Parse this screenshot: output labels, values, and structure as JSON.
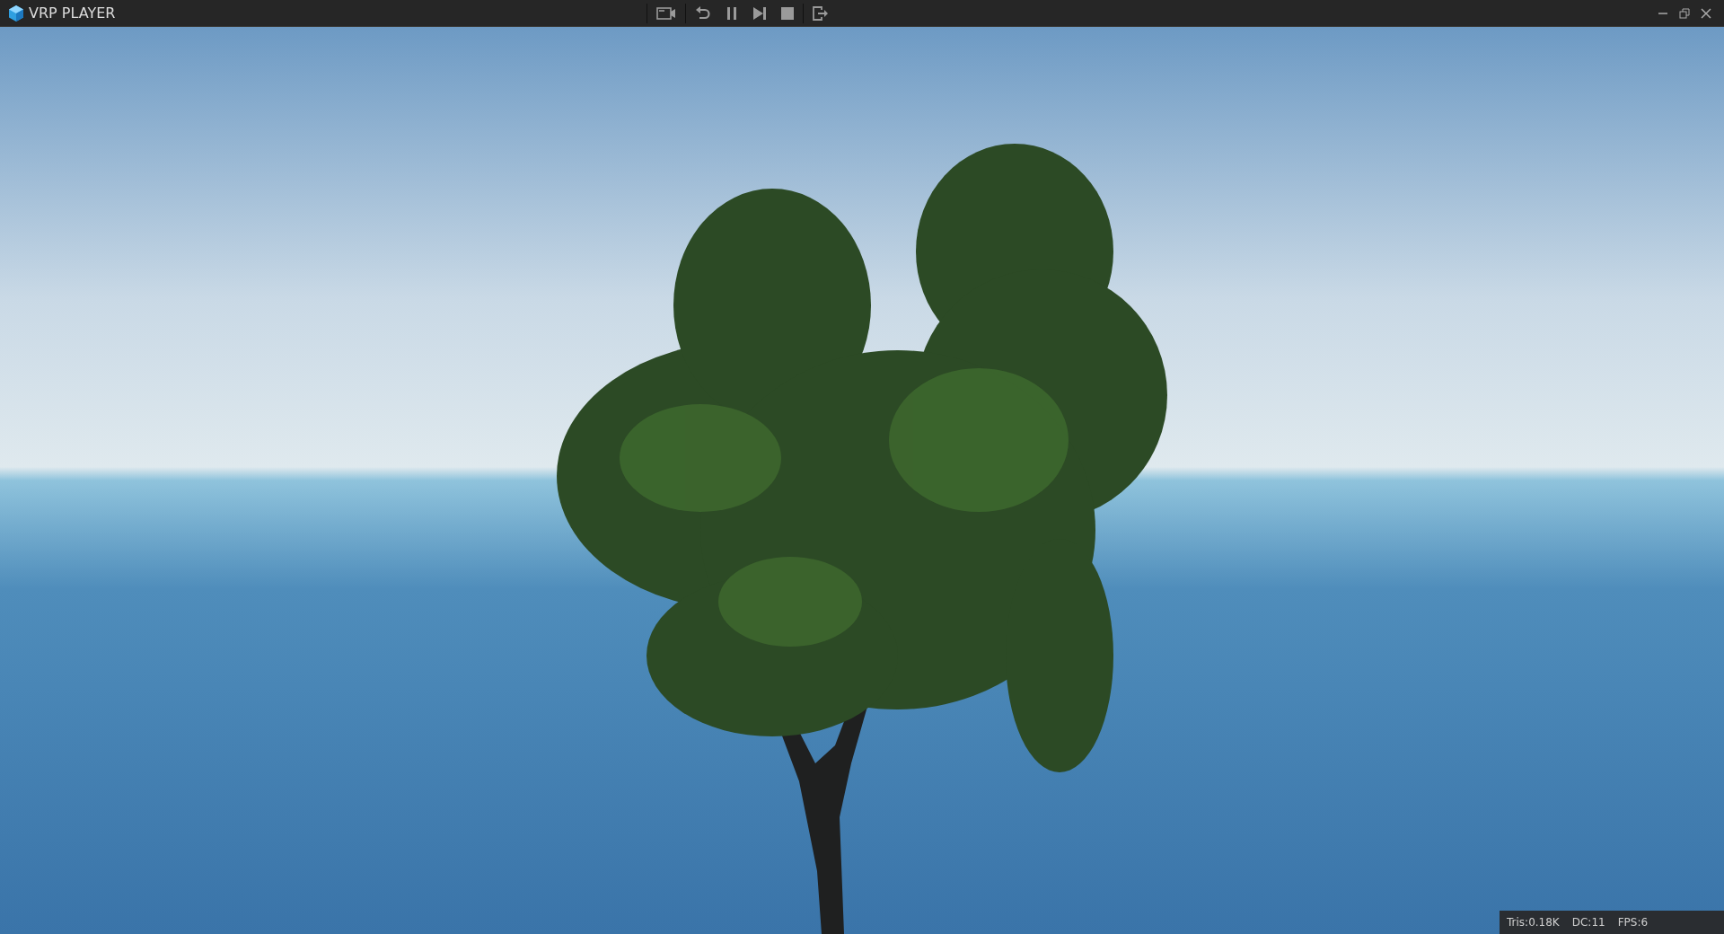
{
  "window": {
    "title": "VRP PLAYER"
  },
  "stats": [
    "Tris:0.18K",
    "DC:11",
    "FPS:6"
  ]
}
